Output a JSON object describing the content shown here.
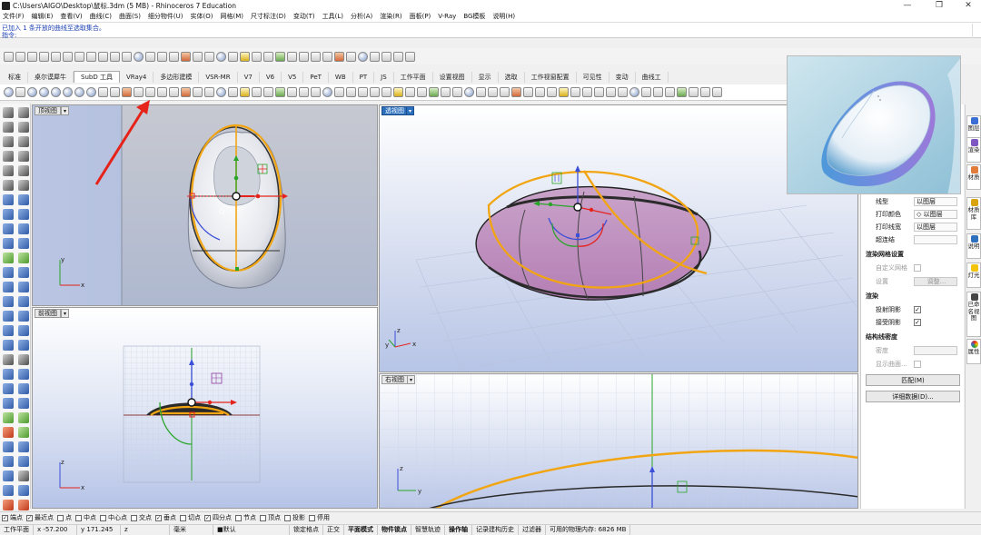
{
  "window": {
    "title": "C:\\Users\\AIGO\\Desktop\\鼠标.3dm (5 MB) - Rhinoceros 7 Education",
    "controls": [
      "—",
      "❐",
      "✕"
    ]
  },
  "menu": [
    "文件(F)",
    "编辑(E)",
    "查看(V)",
    "曲线(C)",
    "曲面(S)",
    "细分物件(U)",
    "实体(O)",
    "网格(M)",
    "尺寸标注(D)",
    "变动(T)",
    "工具(L)",
    "分析(A)",
    "渲染(R)",
    "面板(P)",
    "V-Ray",
    "BG模板",
    "说明(H)"
  ],
  "command": {
    "history": "已加入 1 条开放的曲线至选取集合。",
    "prompt": "指令:"
  },
  "tabs": {
    "items": [
      "标准",
      "桌尔谟犀牛",
      "SubD 工具",
      "VRay4",
      "多边形建模",
      "VSR-MR",
      "V7",
      "V6",
      "V5",
      "PeT",
      "WB",
      "PT",
      "JS",
      "工作平面",
      "设置视图",
      "显示",
      "选取",
      "工作视窗配置",
      "可见性",
      "变动",
      "曲线工"
    ],
    "active_index": 2
  },
  "viewports": {
    "top": {
      "label": "顶视图"
    },
    "perspective": {
      "label": "透视图"
    },
    "front": {
      "label": "前视图"
    },
    "right": {
      "label": "右视图"
    }
  },
  "axes": {
    "x": "x",
    "y": "y",
    "z": "z"
  },
  "properties": {
    "rows": [
      {
        "key": "线型",
        "value": "以图层"
      },
      {
        "key": "打印颜色",
        "value": "◇ 以图层"
      },
      {
        "key": "打印线宽",
        "value": "以图层"
      },
      {
        "key": "超连结",
        "value": ""
      }
    ],
    "mesh_section": "渲染网格设置",
    "custom_mesh": "自定义网格",
    "settings": "设置",
    "adjust": "调整...",
    "render_section": "渲染",
    "cast_shadows": "投射阴影",
    "receive_shadows": "接受阴影",
    "structure_section": "结构线密度",
    "density": "密度",
    "show_surface": "显示曲面...",
    "match_button": "匹配(M)",
    "details_button": "详细数据(D)..."
  },
  "side_tabs": [
    "图层",
    "渲染",
    "材质",
    "材质库",
    "说明",
    "灯光",
    "已命名视图",
    "属性"
  ],
  "osnaps": [
    {
      "label": "端点",
      "checked": true
    },
    {
      "label": "最近点",
      "checked": true
    },
    {
      "label": "点",
      "checked": false
    },
    {
      "label": "中点",
      "checked": false
    },
    {
      "label": "中心点",
      "checked": false
    },
    {
      "label": "交点",
      "checked": false
    },
    {
      "label": "垂点",
      "checked": true
    },
    {
      "label": "切点",
      "checked": false
    },
    {
      "label": "四分点",
      "checked": true
    },
    {
      "label": "节点",
      "checked": false
    },
    {
      "label": "顶点",
      "checked": false
    },
    {
      "label": "投影",
      "checked": false
    },
    {
      "label": "停用",
      "checked": false
    }
  ],
  "status": {
    "cplane": "工作平面",
    "x": "x -57.200",
    "y": "y 171.245",
    "z": "z",
    "units": "毫米",
    "layer": "■默认",
    "grid_snap": "锁定格点",
    "ortho": "正交",
    "planar": "平面模式",
    "osnap": "物件锁点",
    "smarttrack": "智慧轨迹",
    "gumball": "操作轴",
    "history": "记录建构历史",
    "filter": "过滤器",
    "memory": "可用的物理内存: 6826 MB"
  },
  "colors": {
    "curve_orange": "#f2a512",
    "viewport_blue_top": "#aab3c4",
    "viewport_blue_bottom": "#c9d3ea",
    "active_label": "#2c6fbd",
    "annotation_red": "#e5231b"
  }
}
